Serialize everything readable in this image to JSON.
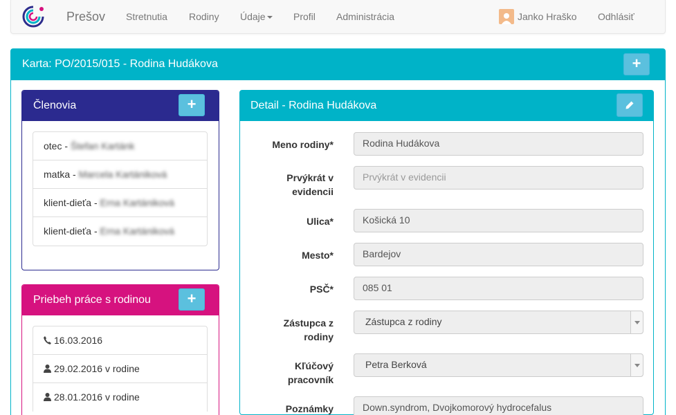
{
  "navbar": {
    "brand": "Prešov",
    "items": [
      "Stretnutia",
      "Rodiny",
      "Údaje",
      "Profil",
      "Administrácia"
    ],
    "user_name": "Janko Hraško",
    "logout": "Odhlásiť"
  },
  "card": {
    "title": "Karta: PO/2015/015 - Rodina Hudákova",
    "add_icon": "plus-icon"
  },
  "members": {
    "title": "Členovia",
    "color": "#2b2a8f",
    "items": [
      {
        "role": "otec - ",
        "name": "Štefan Kartánk"
      },
      {
        "role": "matka - ",
        "name": "Marcela Kartániková"
      },
      {
        "role": "klient-dieťa - ",
        "name": "Erna Kartániková"
      },
      {
        "role": "klient-dieťa - ",
        "name": "Erna Kartániková"
      }
    ]
  },
  "progress": {
    "title": "Priebeh práce s rodinou",
    "color": "#d6127f",
    "items": [
      {
        "icon": "phone-icon",
        "text": "16.03.2016"
      },
      {
        "icon": "user-icon",
        "text": "29.02.2016 v rodine"
      },
      {
        "icon": "user-icon",
        "text": "28.01.2016 v rodine"
      }
    ]
  },
  "detail": {
    "title": "Detail - Rodina Hudákova",
    "edit_icon": "pencil-icon",
    "fields": {
      "meno": {
        "label": "Meno rodiny*",
        "value": "Rodina Hudákova"
      },
      "prvykrat": {
        "label": "Prvýkrát v evidencii",
        "placeholder": "Prvýkrát v evidencii"
      },
      "ulica": {
        "label": "Ulica*",
        "value": "Košická  10"
      },
      "mesto": {
        "label": "Mesto*",
        "value": "Bardejov"
      },
      "psc": {
        "label": "PSČ*",
        "value": "085 01"
      },
      "zastupca": {
        "label": "Zástupca z rodiny",
        "value": "Zástupca z rodiny"
      },
      "pracovnik": {
        "label": "Kľúčový pracovník",
        "value": "Petra Berková"
      },
      "poznamky": {
        "label": "Poznámky",
        "value": "Down.syndrom, Dvojkomorový hydrocefalus"
      }
    }
  },
  "colors": {
    "accent": "#00b3c8",
    "button": "#5bc0de"
  }
}
